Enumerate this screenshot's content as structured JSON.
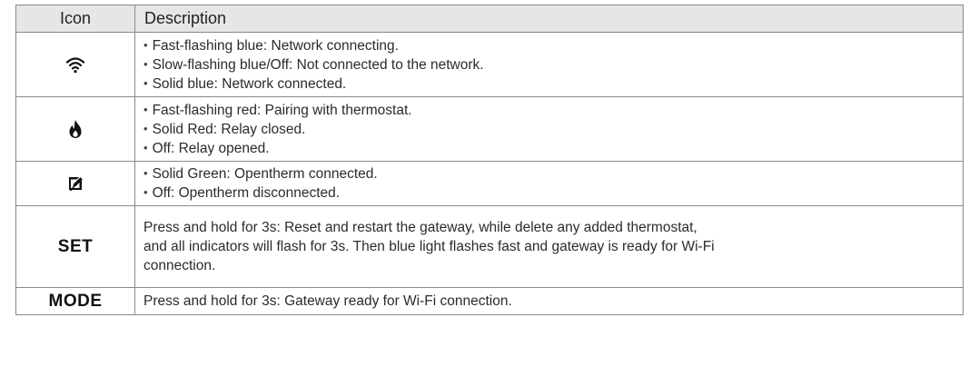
{
  "table": {
    "headers": {
      "icon": "Icon",
      "description": "Description"
    },
    "rows": [
      {
        "icon": "wifi-icon",
        "items": [
          "Fast-flashing blue: Network connecting.",
          "Slow-flashing blue/Off: Not connected to the network.",
          "Solid blue: Network connected."
        ]
      },
      {
        "icon": "flame-icon",
        "items": [
          "Fast-flashing red: Pairing with thermostat.",
          "Solid Red: Relay closed.",
          "Off: Relay opened."
        ]
      },
      {
        "icon": "opentherm-icon",
        "items": [
          "Solid Green: Opentherm connected.",
          "Off: Opentherm disconnected."
        ]
      },
      {
        "label": "SET",
        "text_lines": [
          "Press and hold for 3s: Reset and restart the gateway, while delete any added thermostat,",
          "and all indicators will flash for 3s. Then blue light flashes fast and gateway is ready for Wi-Fi",
          "connection."
        ]
      },
      {
        "label": "MODE",
        "text_lines": [
          "Press and hold for 3s: Gateway ready for Wi-Fi connection."
        ]
      }
    ]
  }
}
